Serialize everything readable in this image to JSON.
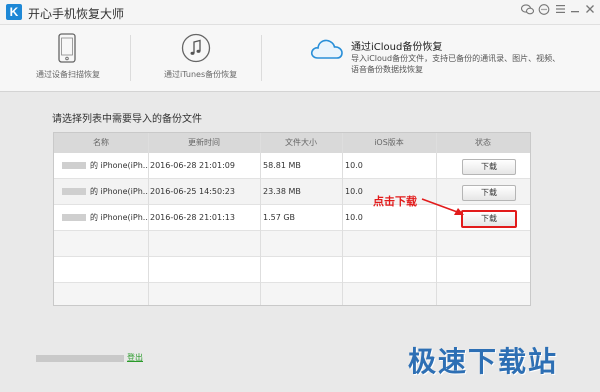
{
  "app": {
    "title": "开心手机恢复大师",
    "logo_letter": "K"
  },
  "nav": {
    "scan_device": {
      "label": "通过设备扫描恢复"
    },
    "itunes": {
      "label": "通过iTunes备份恢复"
    },
    "icloud": {
      "title": "通过iCloud备份恢复",
      "desc": "导入iCloud备份文件，支持已备份的通讯录、图片、视频、语音备份数据找恢复"
    }
  },
  "instruction": "请选择列表中需要导入的备份文件",
  "table": {
    "headers": [
      "名称",
      "更新时间",
      "文件大小",
      "iOS版本",
      "状态"
    ],
    "rows": [
      {
        "name": "的 iPhone(iPh...",
        "time": "2016-06-28 21:01:09",
        "size": "58.81 MB",
        "ios": "10.0",
        "action": "下载"
      },
      {
        "name": "的 iPhone(iPh...",
        "time": "2016-06-25 14:50:23",
        "size": "23.38 MB",
        "ios": "10.0",
        "action": "下载"
      },
      {
        "name": "的 iPhone(iPh...",
        "time": "2016-06-28 21:01:13",
        "size": "1.57 GB",
        "ios": "10.0",
        "action": "下载"
      }
    ]
  },
  "annotation": "点击下载",
  "footer": {
    "logout": "登出"
  },
  "watermark": "极速下载站",
  "colors": {
    "accent": "#1e88d6",
    "annotation": "#e21b1b",
    "link": "#2a9a2a"
  }
}
